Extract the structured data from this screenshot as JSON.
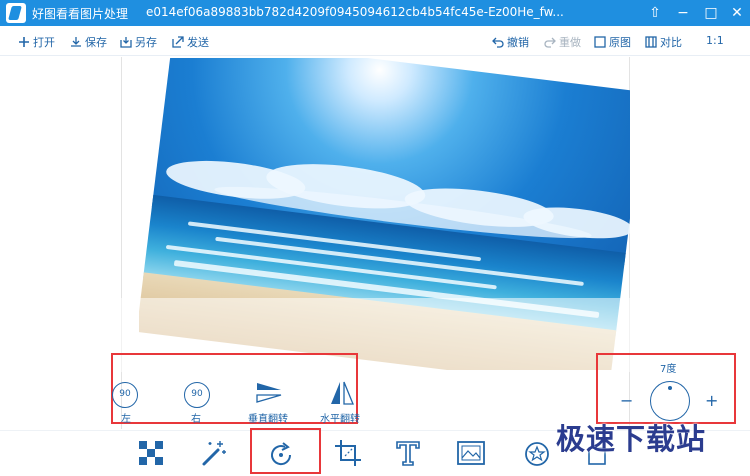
{
  "window": {
    "app_name": "好图看看图片处理",
    "file_name": "e014ef06a89883bb782d4209f0945094612cb4b54fc45e-Ez00He_fw...",
    "controls": [
      "⇧",
      "−",
      "□",
      "✕"
    ]
  },
  "toolbar": {
    "open": "打开",
    "save": "保存",
    "save_as": "另存",
    "send": "发送",
    "undo": "撤销",
    "redo": "重做",
    "original": "原图",
    "compare": "对比",
    "zoom": "1:1"
  },
  "rotate_panel": {
    "left_label": "左",
    "right_label": "右",
    "vflip_label": "垂直翻转",
    "hflip_label": "水平翻转",
    "left_badge": "90",
    "right_badge": "90"
  },
  "angle": {
    "value_label": "7度",
    "minus": "−",
    "plus": "+",
    "degrees": 7
  },
  "bottom_tools": [
    {
      "name": "mosaic-icon"
    },
    {
      "name": "magic-wand-icon"
    },
    {
      "name": "rotate-icon"
    },
    {
      "name": "crop-icon"
    },
    {
      "name": "text-icon"
    },
    {
      "name": "frame-icon"
    },
    {
      "name": "sticker-icon"
    },
    {
      "name": "more-icon"
    }
  ],
  "watermark": "极速下载站",
  "colors": {
    "titlebar": "#1f8fe0",
    "accent": "#2266a8",
    "highlight": "#e8373a"
  }
}
